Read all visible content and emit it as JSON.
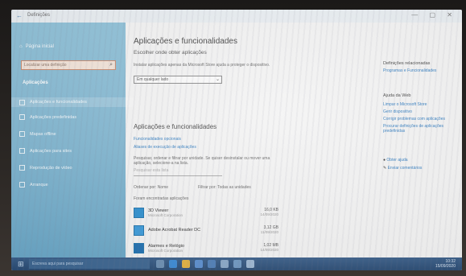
{
  "window": {
    "title": "Definições",
    "controls": "—  ▢  ✕"
  },
  "sidebar": {
    "home_label": "Página inicial",
    "search_placeholder": "Localizar uma definição",
    "heading": "Aplicações",
    "items": [
      {
        "label": "Aplicações e funcionalidades",
        "icon": "list-icon"
      },
      {
        "label": "Aplicações predefinidas",
        "icon": "defaults-icon"
      },
      {
        "label": "Mapas offline",
        "icon": "map-icon"
      },
      {
        "label": "Aplicações para sites",
        "icon": "web-icon"
      },
      {
        "label": "Reprodução de vídeo",
        "icon": "video-icon"
      },
      {
        "label": "Arranque",
        "icon": "startup-icon"
      }
    ]
  },
  "main": {
    "title": "Aplicações e funcionalidades",
    "subtitle": "Escolher onde obter aplicações",
    "intro": "Instalar aplicações apenas da Microsoft Store ajuda a proteger o dispositivo.",
    "combo_value": "Em qualquer lado",
    "section_title": "Aplicações e funcionalidades",
    "links": [
      "Funcionalidades opcionais",
      "Aliases de execução de aplicações"
    ],
    "search_intro": "Pesquisar, ordenar e filtrar por unidade. Se quiser desinstalar ou mover uma aplicação, selecione-a na lista.",
    "search_placeholder": "Pesquisar esta lista",
    "sort_label": "Ordenar por: Nome",
    "filter_label": "Filtrar por: Todas as unidades",
    "count_label": "Foram encontradas aplicações",
    "apps": [
      {
        "name": "3D Viewer",
        "publisher": "Microsoft Corporation",
        "size": "16,0 KB",
        "date": "14/09/2020"
      },
      {
        "name": "Adobe Acrobat Reader DC",
        "publisher": "",
        "size": "3,12 GB",
        "date": "11/09/2020"
      },
      {
        "name": "Alarmes e Relógio",
        "publisher": "Microsoft Corporation",
        "size": "1,02 MB",
        "date": "14/09/2020"
      }
    ]
  },
  "right": {
    "related_heading": "Definições relacionadas",
    "related_links": [
      "Programas e Funcionalidades"
    ],
    "help_heading": "Ajuda da Web",
    "help_links": [
      "Limpar o Microsoft Store",
      "Gerir dispositivo",
      "Corrigir problemas com aplicações",
      "Procurar definições de aplicações predefinidas"
    ],
    "actions": [
      "Obter ajuda",
      "Enviar comentários"
    ]
  },
  "taskbar": {
    "search_placeholder": "Escreva aqui para pesquisar",
    "time": "10:32",
    "date": "15/09/2020"
  },
  "colors": {
    "sidebar": "#7eb4cf",
    "accent": "#2f7bbf",
    "taskbar": "#2a4b73"
  }
}
